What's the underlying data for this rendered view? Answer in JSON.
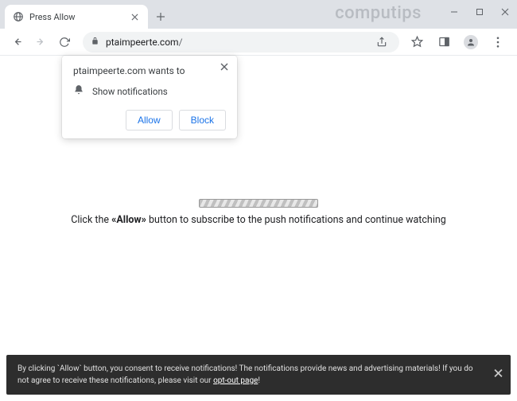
{
  "window": {
    "watermark": "computips"
  },
  "tab": {
    "title": "Press Allow"
  },
  "address": {
    "domain": "ptaimpeerte.com",
    "path": "/"
  },
  "prompt": {
    "site_wants_to": "ptaimpeerte.com wants to",
    "permission_label": "Show notifications",
    "allow_label": "Allow",
    "block_label": "Block"
  },
  "page": {
    "instruction_prefix": "Click the ",
    "instruction_bold": "«Allow»",
    "instruction_suffix": " button to subscribe to the push notifications and continue watching"
  },
  "footer": {
    "text_prefix": "By clicking `Allow` button, you consent to receive notifications! The notifications provide news and advertising materials! If you do not agree to receive these notifications, please visit our ",
    "link_text": "opt-out page",
    "text_suffix": "!"
  }
}
